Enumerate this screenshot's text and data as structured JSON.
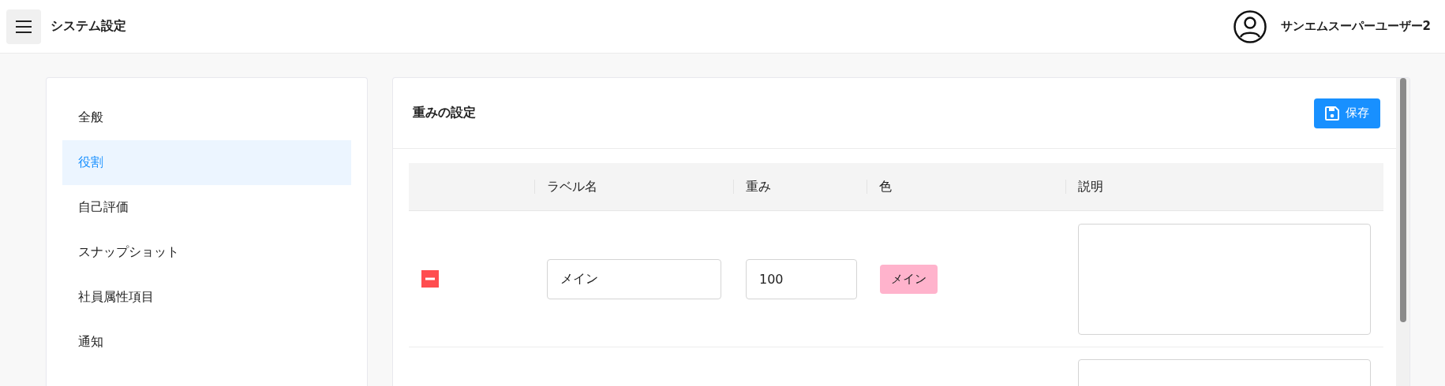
{
  "header": {
    "title": "システム設定",
    "user_name": "サンエムスーパーユーザー2"
  },
  "sidebar": {
    "items": [
      {
        "label": "全般",
        "selected": false
      },
      {
        "label": "役割",
        "selected": true
      },
      {
        "label": "自己評価",
        "selected": false
      },
      {
        "label": "スナップショット",
        "selected": false
      },
      {
        "label": "社員属性項目",
        "selected": false
      },
      {
        "label": "通知",
        "selected": false
      }
    ]
  },
  "panel": {
    "title": "重みの設定",
    "save_button": "保存",
    "table": {
      "columns": [
        "ラベル名",
        "重み",
        "色",
        "説明"
      ],
      "rows": [
        {
          "kind": "full",
          "label_name": "メイン",
          "weight": "100",
          "tag": {
            "label": "メイン",
            "color": "#ffb3cc"
          }
        },
        {
          "kind": "cut"
        }
      ]
    }
  }
}
